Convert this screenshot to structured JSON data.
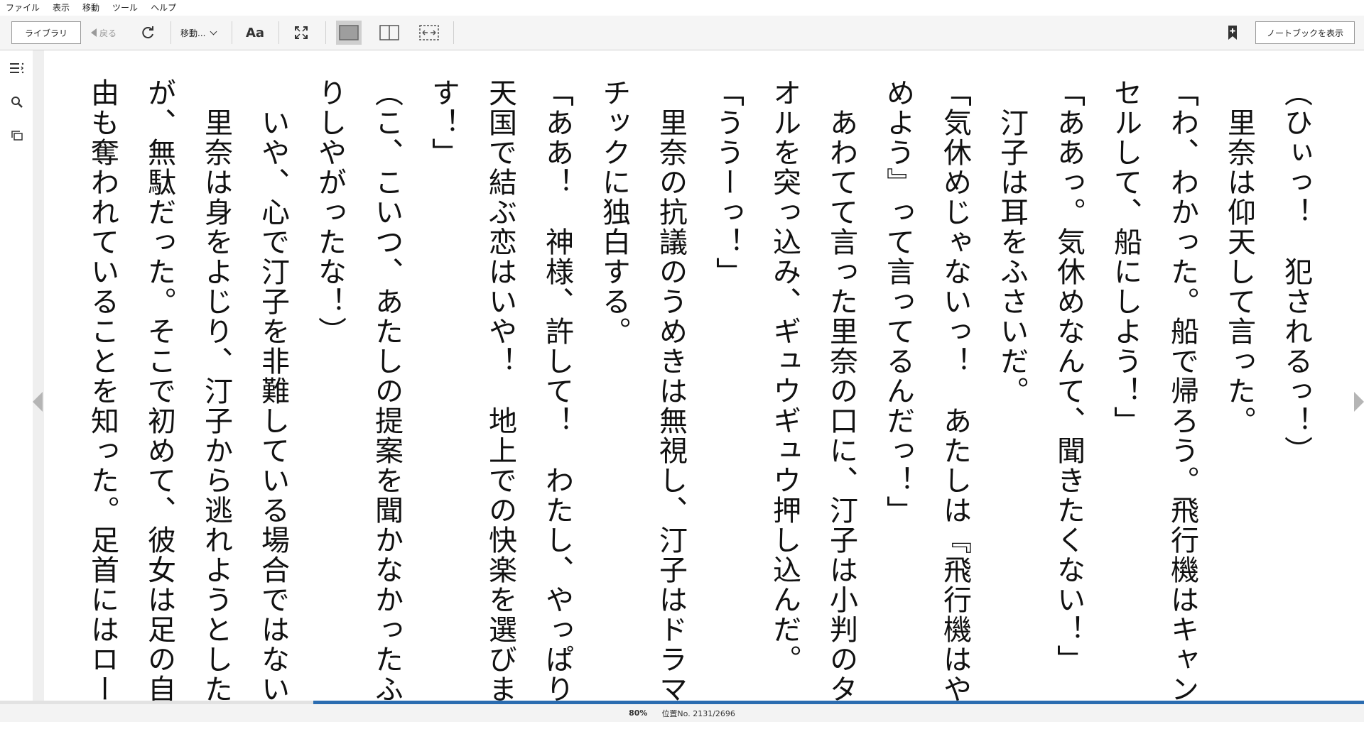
{
  "menu": [
    "ファイル",
    "表示",
    "移動",
    "ツール",
    "ヘルプ"
  ],
  "toolbar": {
    "library_label": "ライブラリ",
    "back_label": "戻る",
    "goto_label": "移動...",
    "font_label": "Aa",
    "notebook_label": "ノートブックを表示"
  },
  "content": {
    "columns": [
      "（ひぃっ！　犯されるっ！）",
      "　里奈は仰天して言った。",
      "「わ、わかった。船で帰ろう。飛行機はキャン",
      "セルして、船にしよう！」",
      "「ああっ。気休めなんて、聞きたくない！」",
      "　汀子は耳をふさいだ。",
      "「気休めじゃないっ！　あたしは『飛行機はや",
      "めよう』って言ってるんだっ！」",
      "　あわてて言った里奈の口に、汀子は小判のタ",
      "オルを突っ込み、ギュウギュウ押し込んだ。",
      "「ううーっ！」",
      "　里奈の抗議のうめきは無視し、汀子はドラマ",
      "チックに独白する。",
      "「ああ！　神様、許して！　わたし、やっぱり、",
      "天国で結ぶ恋はいや！　地上での快楽を選びま",
      "す！」",
      "（こ、こいつ、あたしの提案を聞かなかったふ",
      "りしやがったな！）",
      "　いや、心で汀子を非難している場合ではない。",
      "　里奈は身をよじり、汀子から逃れようとした",
      "が、無駄だった。そこで初めて、彼女は足の自",
      "由も奪われていることを知った。足首にはロー"
    ]
  },
  "status": {
    "percent": "80%",
    "progress": 0.8,
    "location": "位置No. 2131/2696"
  },
  "colors": {
    "accent": "#2b6cb0",
    "toolbar_bg": "#f5f5f5"
  }
}
